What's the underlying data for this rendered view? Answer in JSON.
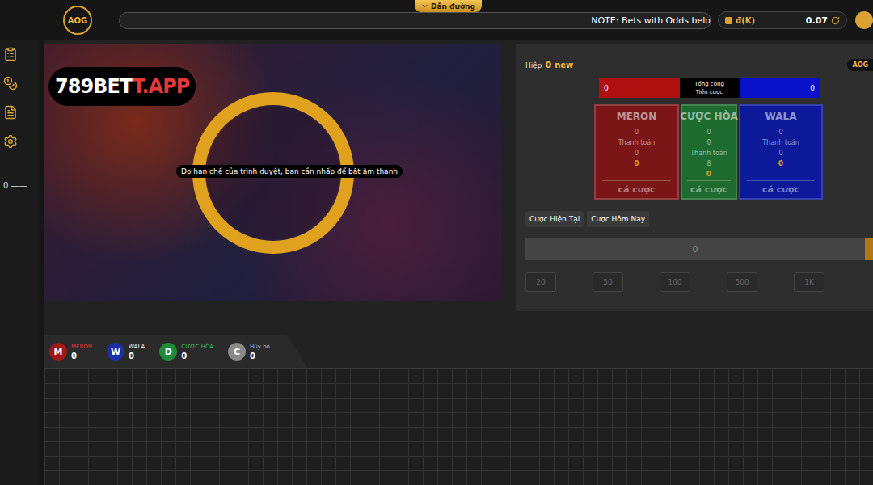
{
  "topbar": {
    "logo": "AOG",
    "guide": "Dẫn đường",
    "notice": "NOTE: Bets with Odds belo",
    "currency": "đ(K)",
    "balance": "0.07"
  },
  "sidebar": {
    "reading": "0 ——"
  },
  "video": {
    "watermark_main": "789BET",
    "watermark_accent": "T.APP",
    "sound_notice": "Do hạn chế của trình duyệt, bạn cần nhấp để bật âm thanh"
  },
  "round": {
    "label": "Hiệp",
    "number": "0",
    "status": "new"
  },
  "provider_badge": "AOG",
  "totals": {
    "left": "0",
    "label_top": "Tổng cộng",
    "label_bottom": "Tiền cược",
    "right": "0"
  },
  "bet_cards": [
    {
      "name": "MERON",
      "color": "#7a1616",
      "lines": [
        "0",
        "Thanh toán",
        "0"
      ],
      "stake": "0",
      "action": "cá cược"
    },
    {
      "name": "CƯỢC HÒA",
      "color": "#1d6b2e",
      "lines": [
        "0",
        "0",
        "Thanh toán",
        "8"
      ],
      "stake": "0",
      "action": "cá cược"
    },
    {
      "name": "WALA",
      "color": "#0c1a9a",
      "lines": [
        "0",
        "Thanh toán",
        "0"
      ],
      "stake": "0",
      "action": "cá cược"
    }
  ],
  "tabs": [
    {
      "label": "Cược Hiện Tại",
      "selected": false
    },
    {
      "label": "Cược Hôm Nay",
      "selected": false
    }
  ],
  "amount": "0",
  "chips": [
    "20",
    "50",
    "100",
    "500",
    "1K"
  ],
  "legend": [
    {
      "badge": "M",
      "label": "MERON",
      "count": "0",
      "color": "#a01818",
      "label_color": "#e03030"
    },
    {
      "badge": "W",
      "label": "WALA",
      "count": "0",
      "color": "#1b2ea8",
      "label_color": "#ffffff"
    },
    {
      "badge": "D",
      "label": "CƯỢC HÒA",
      "count": "0",
      "color": "#1f8a3b",
      "label_color": "#3fbf5f"
    },
    {
      "badge": "C",
      "label": "Hủy bỏ",
      "count": "0",
      "color": "#8a8a8a",
      "label_color": "#bdbdbd"
    }
  ]
}
